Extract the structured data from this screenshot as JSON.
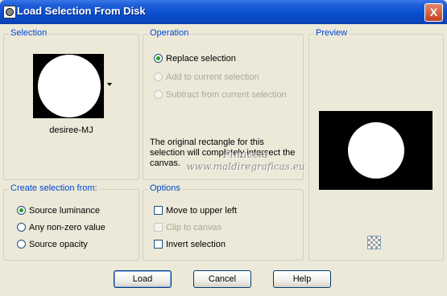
{
  "window": {
    "title": "Load Selection From Disk",
    "close_glyph": "X"
  },
  "selection": {
    "label": "Selection",
    "file_name": "desiree-MJ"
  },
  "operation": {
    "label": "Operation",
    "options": [
      {
        "label": "Replace selection",
        "checked": true,
        "enabled": true
      },
      {
        "label": "Add to current selection",
        "checked": false,
        "enabled": false
      },
      {
        "label": "Subtract from current selection",
        "checked": false,
        "enabled": false
      }
    ],
    "description": "The original rectangle for this selection will completely intersect the canvas."
  },
  "watermark": {
    "line1": "Pinuccia",
    "line2": "www.maldiregraficas.eu"
  },
  "preview": {
    "label": "Preview"
  },
  "create_from": {
    "label": "Create selection from:",
    "options": [
      {
        "label": "Source luminance",
        "checked": true
      },
      {
        "label": "Any non-zero value",
        "checked": false
      },
      {
        "label": "Source opacity",
        "checked": false
      }
    ]
  },
  "options": {
    "label": "Options",
    "items": [
      {
        "label": "Move to upper left",
        "checked": false,
        "enabled": true
      },
      {
        "label": "Clip to canvas",
        "checked": false,
        "enabled": false
      },
      {
        "label": "Invert selection",
        "checked": false,
        "enabled": true
      }
    ]
  },
  "buttons": {
    "load": "Load",
    "cancel": "Cancel",
    "help": "Help"
  },
  "colors": {
    "title_bar": "#0a4fcf",
    "group_label": "#0046d5",
    "dialog_bg": "#ece9d8"
  }
}
